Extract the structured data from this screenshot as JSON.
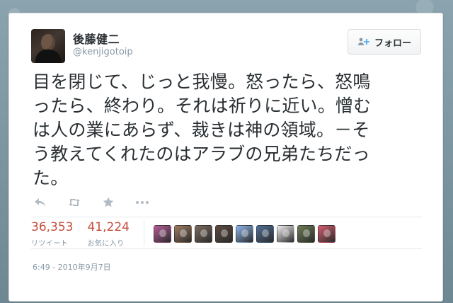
{
  "user": {
    "name": "後藤健二",
    "handle": "@kenjigotoip"
  },
  "follow_button": {
    "label": "フォロー"
  },
  "tweet": {
    "lines": [
      "目を閉じて、じっと我慢。怒ったら、怒鳴",
      "ったら、終わり。それは祈りに近い。憎む",
      "は人の業にあらず、裁きは神の領域。－そ",
      "う教えてくれたのはアラブの兄弟たちだっ",
      "た。"
    ]
  },
  "actions": [
    {
      "icon": "reply-icon"
    },
    {
      "icon": "retweet-icon"
    },
    {
      "icon": "favorite-star-icon"
    },
    {
      "icon": "more-icon"
    }
  ],
  "stats": {
    "retweets": {
      "value": "36,353",
      "label": "リツイート"
    },
    "favorites": {
      "value": "41,224",
      "label": "お気に入り"
    }
  },
  "engager_avatars": [
    {
      "name": "engager-avatar-1",
      "color": "#b45c98"
    },
    {
      "name": "engager-avatar-2",
      "color": "#9f7c62"
    },
    {
      "name": "engager-avatar-3",
      "color": "#7d6a5d"
    },
    {
      "name": "engager-avatar-4",
      "color": "#5c4a3f"
    },
    {
      "name": "engager-avatar-5",
      "color": "#8fb6ea"
    },
    {
      "name": "engager-avatar-6",
      "color": "#516f97"
    },
    {
      "name": "engager-avatar-7",
      "color": "#f1f1f1"
    },
    {
      "name": "engager-avatar-8",
      "color": "#6d7c53"
    },
    {
      "name": "engager-avatar-9",
      "color": "#d45d6e"
    }
  ],
  "timestamp": "6:49 - 2010年9月7日",
  "colors": {
    "stat_number": "#c64f3e",
    "muted_text": "#8899a6",
    "border": "#e1e8ed"
  }
}
